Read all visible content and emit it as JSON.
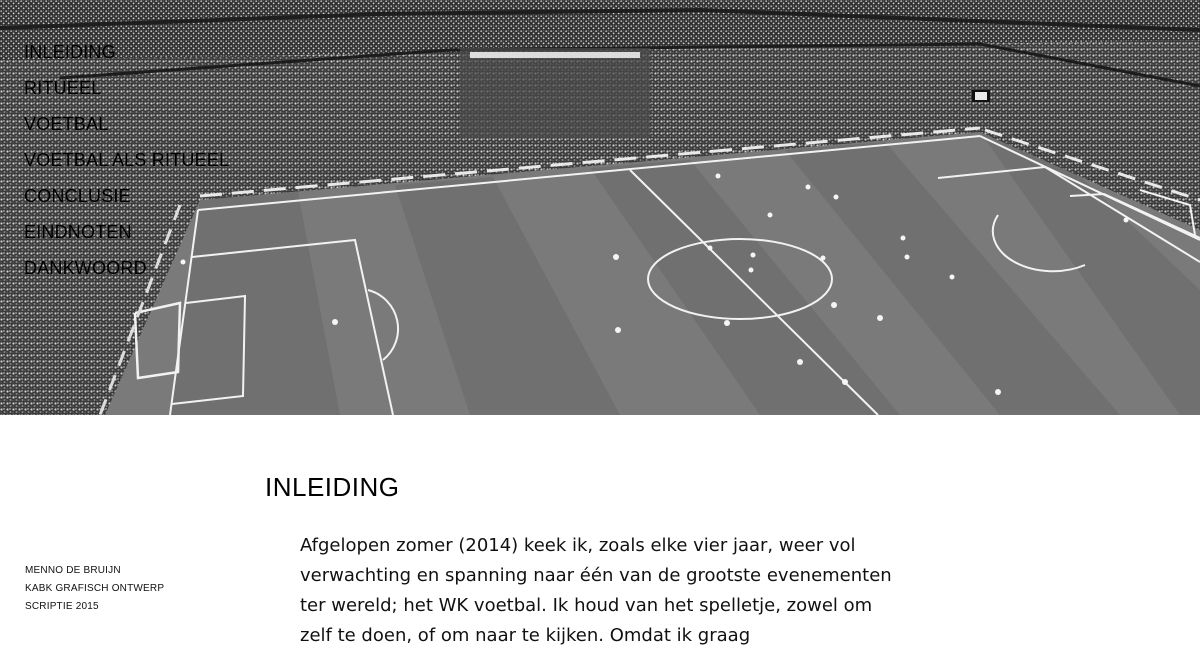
{
  "nav": {
    "items": [
      {
        "label": "INLEIDING"
      },
      {
        "label": "RITUEEL"
      },
      {
        "label": "VOETBAL"
      },
      {
        "label": "VOETBAL ALS RITUEEL"
      },
      {
        "label": "CONCLUSIE"
      },
      {
        "label": "EINDNOTEN"
      },
      {
        "label": "DANKWOORD"
      }
    ]
  },
  "hero": {
    "image": "football-stadium-photo"
  },
  "meta": {
    "author": "MENNO DE BRUIJN",
    "school": "KABK GRAFISCH ONTWERP",
    "course": "SCRIPTIE 2015"
  },
  "section": {
    "title": "INLEIDING",
    "paragraph": "Afgelopen zomer (2014) keek ik, zoals elke vier jaar, weer vol verwachting en spanning naar één van de grootste evenementen ter wereld; het WK voetbal. Ik houd van het spelletje, zowel om zelf te doen, of om naar te kijken. Omdat ik graag"
  }
}
